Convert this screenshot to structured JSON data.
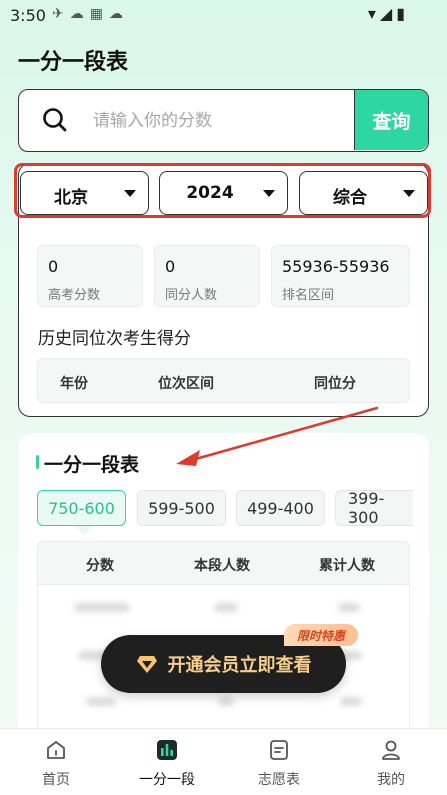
{
  "status_bar": {
    "time": "3:50",
    "left_icons": [
      "bird-icon",
      "cloud-icon",
      "grid-icon",
      "cloud-icon"
    ],
    "right_icons": [
      "wifi-icon",
      "signal-icon",
      "battery-icon"
    ]
  },
  "page": {
    "title": "一分一段表"
  },
  "search": {
    "placeholder": "请输入你的分数",
    "button_label": "查询"
  },
  "filters": [
    {
      "label": "北京"
    },
    {
      "label": "2024"
    },
    {
      "label": "综合"
    }
  ],
  "stats": [
    {
      "value": "0",
      "label": "高考分数"
    },
    {
      "value": "0",
      "label": "同分人数"
    },
    {
      "value": "55936-55936",
      "label": "排名区间"
    }
  ],
  "history": {
    "title": "历史同位次考生得分",
    "columns": [
      "年份",
      "位次区间",
      "同位分"
    ]
  },
  "score_table": {
    "title": "一分一段表",
    "ranges": [
      "750-600",
      "599-500",
      "499-400",
      "399-300"
    ],
    "active_range": 0,
    "columns": [
      "分数",
      "本段人数",
      "累计人数"
    ]
  },
  "vip": {
    "button_label": "开通会员立即查看",
    "badge": "限时特惠"
  },
  "colors": {
    "accent": "#2ed6a0",
    "highlight_red": "#e03a2e",
    "vip_dark": "#1f1f1f",
    "vip_gold": "#f6cf8a"
  },
  "bottom_nav": [
    {
      "label": "首页",
      "icon": "home-icon"
    },
    {
      "label": "一分一段",
      "icon": "chart-icon",
      "active": true
    },
    {
      "label": "志愿表",
      "icon": "form-icon"
    },
    {
      "label": "我的",
      "icon": "user-icon"
    }
  ]
}
